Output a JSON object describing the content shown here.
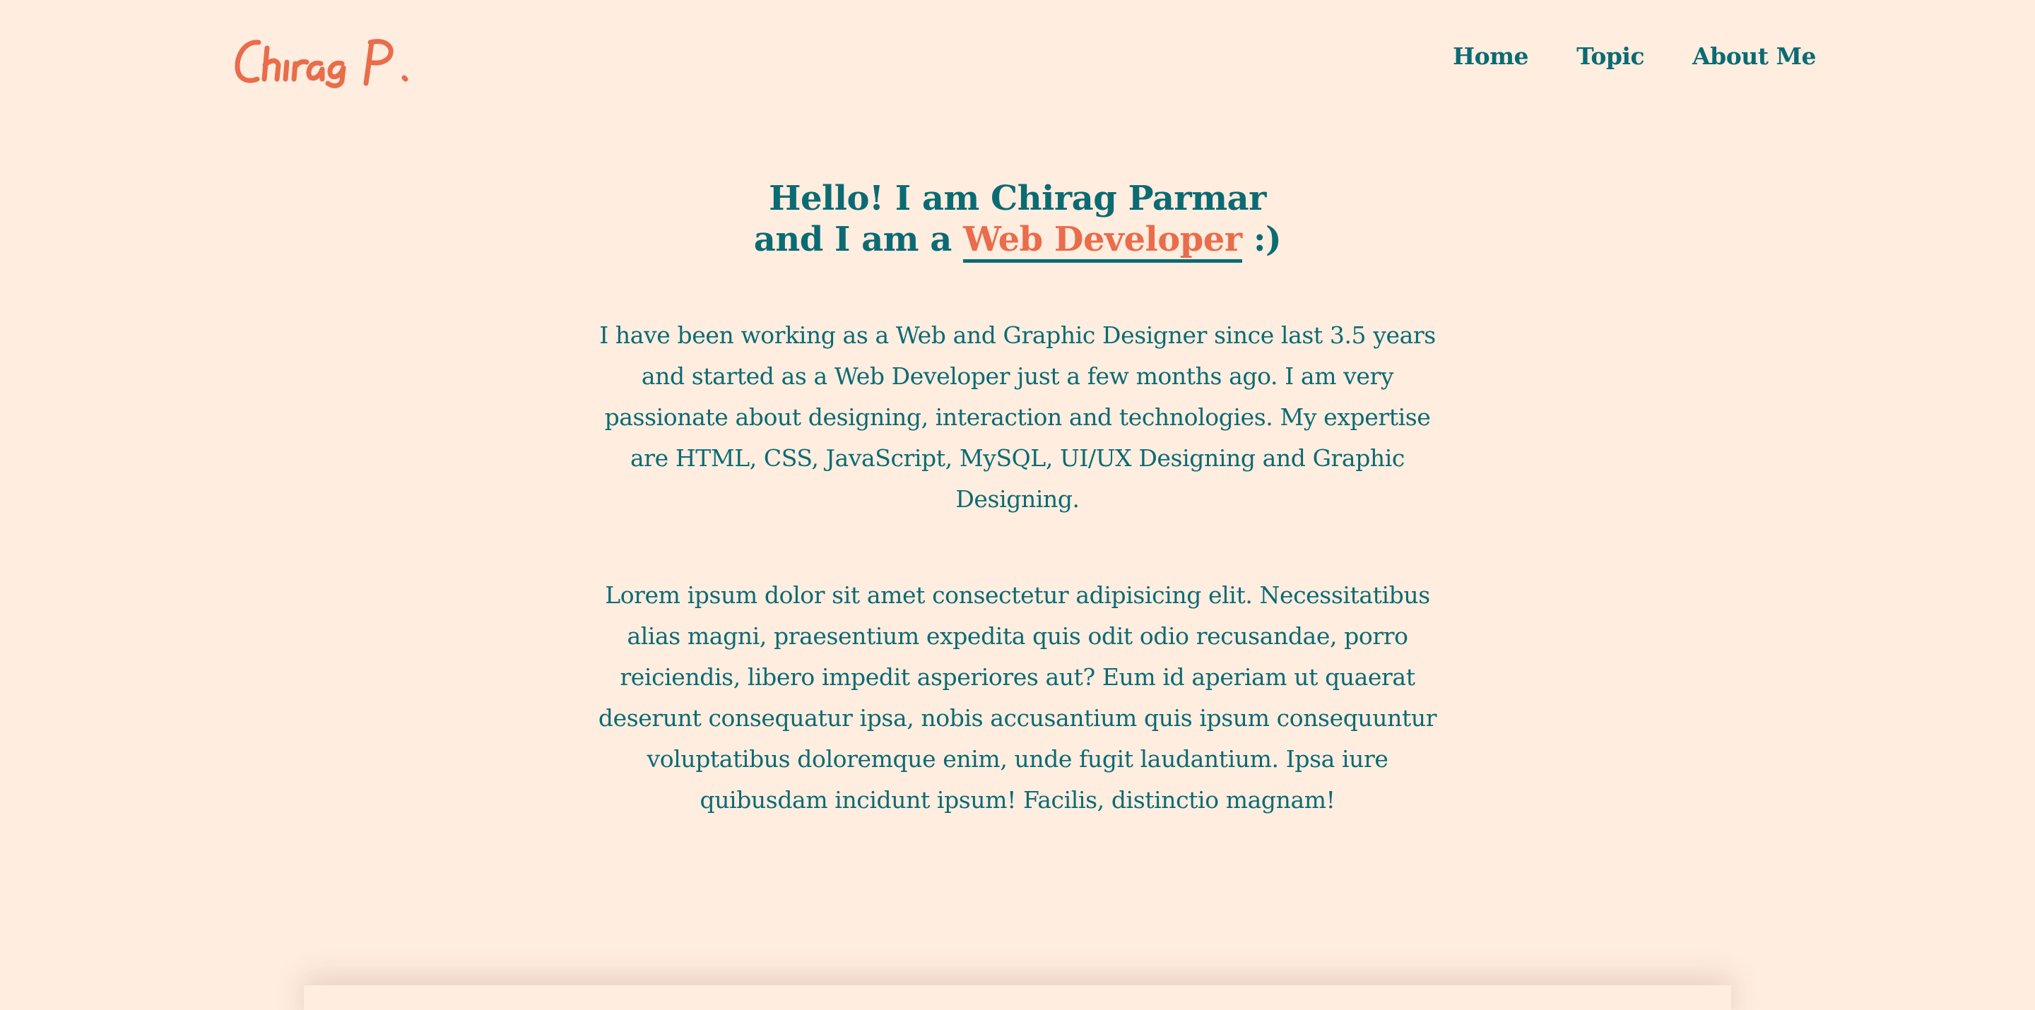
{
  "header": {
    "logo_text": "Chirag P.",
    "nav": [
      {
        "label": "Home"
      },
      {
        "label": "Topic"
      },
      {
        "label": "About Me"
      }
    ]
  },
  "hero": {
    "line1": "Hello! I am Chirag Parmar",
    "line2_prefix": "and I am a ",
    "line2_highlight": "Web Developer",
    "line2_suffix": " :)"
  },
  "content": {
    "paragraph1": "I have been working as a Web and Graphic Designer since last 3.5 years and started as a Web Developer just a few months ago. I am very passionate about designing, interaction and technologies. My expertise are HTML, CSS, JavaScript, MySQL, UI/UX Designing and Graphic Designing.",
    "paragraph2": "Lorem ipsum dolor sit amet consectetur adipisicing elit. Necessitatibus alias magni, praesentium expedita quis odit odio recusandae, porro reiciendis, libero impedit asperiores aut? Eum id aperiam ut quaerat deserunt consequatur ipsa, nobis accusantium quis ipsum consequuntur voluptatibus doloremque enim, unde fugit laudantium. Ipsa iure quibusdam incidunt ipsum! Facilis, distinctio magnam!"
  },
  "colors": {
    "background": "#ffede0",
    "primary": "#0b6b73",
    "accent": "#e96d4b"
  }
}
